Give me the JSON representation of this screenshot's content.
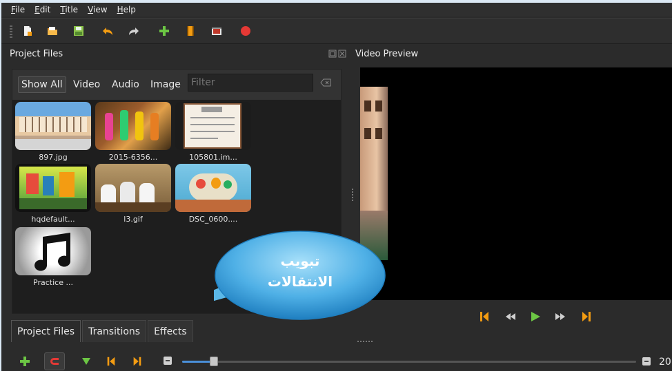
{
  "menu": [
    "File",
    "Edit",
    "Title",
    "View",
    "Help"
  ],
  "toolbar": {
    "icons": [
      "new-project-icon",
      "open-project-icon",
      "save-project-icon",
      "undo-icon",
      "redo-icon",
      "import-files-icon",
      "choose-profile-icon",
      "fullscreen-icon",
      "export-video-icon"
    ]
  },
  "project_files": {
    "title": "Project Files",
    "filters": [
      "Show All",
      "Video",
      "Audio",
      "Image"
    ],
    "filter_placeholder": "Filter",
    "files": [
      {
        "name": "897.jpg"
      },
      {
        "name": "2015-6356..."
      },
      {
        "name": "105801.im..."
      },
      {
        "name": "hqdefault..."
      },
      {
        "name": "l3.gif"
      },
      {
        "name": "DSC_0600...."
      },
      {
        "name": "Practice ..."
      }
    ]
  },
  "tabs": [
    "Project Files",
    "Transitions",
    "Effects"
  ],
  "video_preview": {
    "title": "Video Preview",
    "controls": [
      "jump-start-icon",
      "rewind-icon",
      "play-icon",
      "fast-forward-icon",
      "jump-end-icon"
    ]
  },
  "timeline_toolbar": {
    "zoom_value": "20"
  },
  "callout": {
    "line1": "تبويب",
    "line2": "الانتقالات"
  },
  "colors": {
    "background": "#2b2b2b",
    "accent_orange": "#f39c12",
    "accent_green": "#6cc644",
    "record_red": "#e53935",
    "callout_blue": "#5bb8e8"
  }
}
